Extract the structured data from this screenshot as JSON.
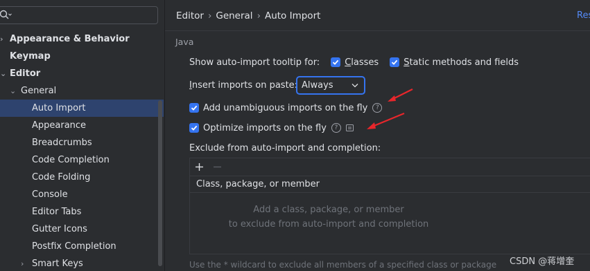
{
  "sidebar": {
    "search_placeholder": "",
    "items": [
      {
        "label": "Appearance & Behavior",
        "bold": true,
        "chevron": "›",
        "indent": 0
      },
      {
        "label": "Keymap",
        "bold": true,
        "chevron": "",
        "indent": 0
      },
      {
        "label": "Editor",
        "bold": true,
        "chevron": "⌄",
        "indent": 0
      },
      {
        "label": "General",
        "bold": false,
        "chevron": "⌄",
        "indent": 1
      },
      {
        "label": "Auto Import",
        "bold": false,
        "chevron": "",
        "indent": 2,
        "selected": true
      },
      {
        "label": "Appearance",
        "bold": false,
        "chevron": "",
        "indent": 2
      },
      {
        "label": "Breadcrumbs",
        "bold": false,
        "chevron": "",
        "indent": 2
      },
      {
        "label": "Code Completion",
        "bold": false,
        "chevron": "",
        "indent": 2
      },
      {
        "label": "Code Folding",
        "bold": false,
        "chevron": "",
        "indent": 2
      },
      {
        "label": "Console",
        "bold": false,
        "chevron": "",
        "indent": 2
      },
      {
        "label": "Editor Tabs",
        "bold": false,
        "chevron": "",
        "indent": 2
      },
      {
        "label": "Gutter Icons",
        "bold": false,
        "chevron": "",
        "indent": 2
      },
      {
        "label": "Postfix Completion",
        "bold": false,
        "chevron": "",
        "indent": 2
      },
      {
        "label": "Smart Keys",
        "bold": false,
        "chevron": "›",
        "indent": 2
      }
    ]
  },
  "breadcrumb": {
    "items": [
      "Editor",
      "General",
      "Auto Import"
    ],
    "separator": "›"
  },
  "reset_label": "Res",
  "section": {
    "title": "Java"
  },
  "tooltip_row": {
    "label": "Show auto-import tooltip for:",
    "classes_label": "Classes",
    "classes_checked": true,
    "static_label": "Static methods and fields",
    "static_checked": true
  },
  "paste_row": {
    "label": "Insert imports on paste:",
    "value": "Always"
  },
  "unambiguous": {
    "label": "Add unambiguous imports on the fly",
    "checked": true
  },
  "optimize": {
    "label": "Optimize imports on the fly",
    "checked": true
  },
  "exclude": {
    "title": "Exclude from auto-import and completion:",
    "add_icon": "plus-icon",
    "remove_icon": "minus-icon",
    "column_header": "Class, package, or member",
    "empty_line1": "Add a class, package, or member",
    "empty_line2": "to exclude from auto-import and completion",
    "hint": "Use the * wildcard to exclude all members of a specified class or package"
  },
  "watermark": "CSDN @蒋增奎",
  "colors": {
    "accent": "#3574f0",
    "selection": "#2e436e",
    "annotation_arrow": "#e8262b",
    "link": "#548af7"
  }
}
